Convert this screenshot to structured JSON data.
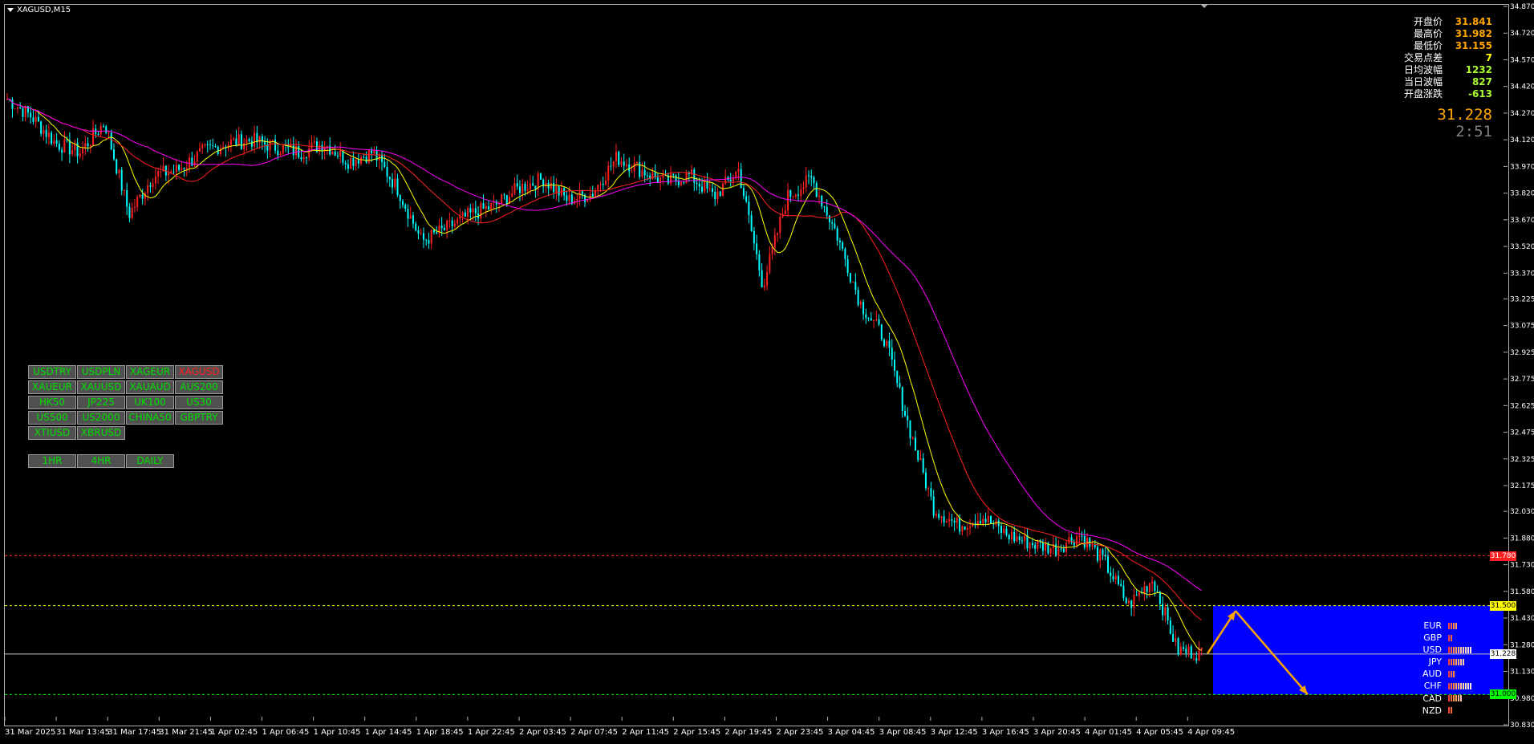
{
  "symbol": "XAGUSD,M15",
  "info": [
    {
      "label": "开盘价",
      "value": "31.841",
      "color": "#ffa500"
    },
    {
      "label": "最高价",
      "value": "31.982",
      "color": "#ffa500"
    },
    {
      "label": "最低价",
      "value": "31.155",
      "color": "#ffa500"
    },
    {
      "label": "交易点差",
      "value": "7",
      "color": "#ffff00"
    },
    {
      "label": "日均波幅",
      "value": "1232",
      "color": "#adff2f"
    },
    {
      "label": "当日波幅",
      "value": "827",
      "color": "#adff2f"
    },
    {
      "label": "开盘涨跌",
      "value": "-613",
      "color": "#adff2f"
    }
  ],
  "current_price": "31.228",
  "countdown": "2:51",
  "symbol_buttons": [
    "USDTRY",
    "USDPLN",
    "XAGEUR",
    "XAGUSD",
    "XAUEUR",
    "XAUUSD",
    "XAUAUD",
    "AUS200",
    "HK50",
    "JP225",
    "UK100",
    "US30",
    "US500",
    "US2000",
    "CHINA50",
    "GBPTRY",
    "XTIUSD",
    "XBRUSD"
  ],
  "active_symbol": "XAGUSD",
  "timeframe_buttons": [
    "1HR",
    "4HR",
    "DAILY"
  ],
  "price_tags": [
    {
      "value": "31.780",
      "level": 31.78,
      "style": "tag-red"
    },
    {
      "value": "31.500",
      "level": 31.5,
      "style": "tag-yellow"
    },
    {
      "value": "31.228",
      "level": 31.228,
      "style": "tag-white"
    },
    {
      "value": "31.000",
      "level": 31.0,
      "style": "tag-green"
    }
  ],
  "currency_strength": [
    {
      "name": "EUR",
      "bars": 4
    },
    {
      "name": "GBP",
      "bars": 2
    },
    {
      "name": "USD",
      "bars": 10
    },
    {
      "name": "JPY",
      "bars": 7
    },
    {
      "name": "AUD",
      "bars": 3
    },
    {
      "name": "CHF",
      "bars": 10
    },
    {
      "name": "CAD",
      "bars": 6
    },
    {
      "name": "NZD",
      "bars": 2
    }
  ],
  "chart_data": {
    "type": "candlestick",
    "title": "XAGUSD,M15",
    "ylim": [
      30.83,
      34.87
    ],
    "y_ticks": [
      "34.870",
      "34.720",
      "34.570",
      "34.420",
      "34.270",
      "34.120",
      "33.970",
      "33.820",
      "33.670",
      "33.520",
      "33.370",
      "33.225",
      "33.075",
      "32.925",
      "32.775",
      "32.625",
      "32.475",
      "32.325",
      "32.175",
      "32.030",
      "31.880",
      "31.730",
      "31.580",
      "31.430",
      "31.280",
      "31.130",
      "30.980",
      "30.830"
    ],
    "x_ticks": [
      "31 Mar 2025",
      "31 Mar 13:45",
      "31 Mar 17:45",
      "31 Mar 21:45",
      "1 Apr 02:45",
      "1 Apr 06:45",
      "1 Apr 10:45",
      "1 Apr 14:45",
      "1 Apr 18:45",
      "1 Apr 22:45",
      "2 Apr 03:45",
      "2 Apr 07:45",
      "2 Apr 11:45",
      "2 Apr 15:45",
      "2 Apr 19:45",
      "2 Apr 23:45",
      "3 Apr 04:45",
      "3 Apr 08:45",
      "3 Apr 12:45",
      "3 Apr 16:45",
      "3 Apr 20:45",
      "4 Apr 01:45",
      "4 Apr 05:45",
      "4 Apr 09:45"
    ],
    "close_path": [
      34.35,
      34.25,
      34.1,
      34.05,
      34.22,
      33.7,
      33.92,
      33.95,
      34.05,
      34.1,
      34.12,
      34.08,
      34.05,
      34.1,
      34.0,
      34.05,
      33.85,
      33.55,
      33.62,
      33.7,
      33.75,
      33.85,
      33.9,
      33.78,
      33.82,
      34.02,
      33.95,
      33.88,
      33.92,
      33.8,
      33.95,
      33.3,
      33.8,
      33.9,
      33.6,
      33.2,
      33.0,
      32.5,
      32.05,
      31.95,
      32.0,
      31.9,
      31.85,
      31.82,
      31.9,
      31.75,
      31.5,
      31.65,
      31.25,
      31.23
    ],
    "horizontal_levels": [
      {
        "price": 31.78,
        "color": "#ff2020",
        "style": "dashed"
      },
      {
        "price": 31.5,
        "color": "#ffff00",
        "style": "dashed"
      },
      {
        "price": 31.228,
        "color": "#c0c0c0",
        "style": "solid"
      },
      {
        "price": 31.0,
        "color": "#00ff00",
        "style": "dashed"
      }
    ],
    "zone": {
      "top": 31.5,
      "bottom": 31.0,
      "color": "#0000ff"
    },
    "projection": [
      {
        "x_frac": 0.0,
        "price": 31.23
      },
      {
        "x_frac": 0.07,
        "price": 31.47
      },
      {
        "x_frac": 0.25,
        "price": 31.0
      }
    ],
    "moving_averages": [
      {
        "color": "#ffff00",
        "period": "fast"
      },
      {
        "color": "#ff2020",
        "period": "medium"
      },
      {
        "color": "#ff00ff",
        "period": "slow"
      }
    ],
    "candle_colors": {
      "up": "#ff2020",
      "down": "#00ffff"
    }
  }
}
